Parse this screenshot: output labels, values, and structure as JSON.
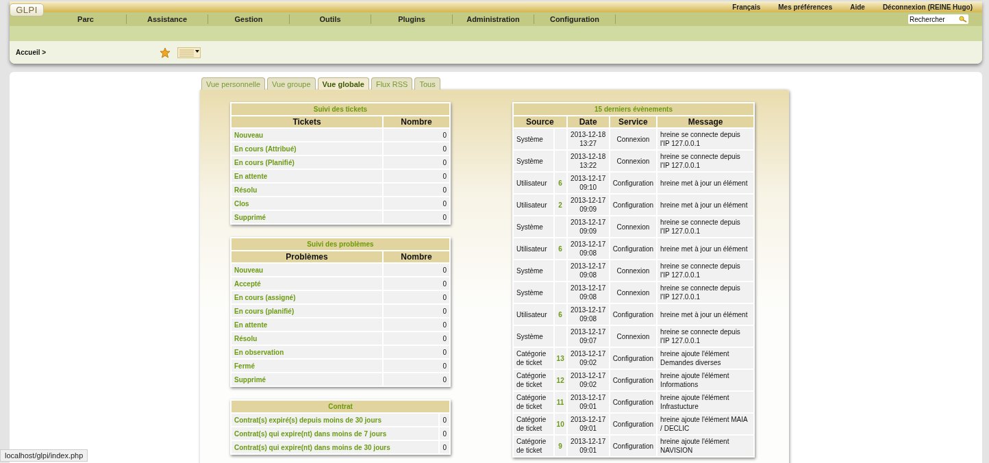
{
  "logo": "GLPI",
  "top_links": [
    "Français",
    "Mes préférences",
    "Aide",
    "Déconnexion (REINE Hugo)"
  ],
  "search": {
    "value": "Rechercher"
  },
  "menu": [
    "Parc",
    "Assistance",
    "Gestion",
    "Outils",
    "Plugins",
    "Administration",
    "Configuration"
  ],
  "breadcrumb": "Accueil >",
  "tabs": [
    {
      "label": "Vue personnelle",
      "selected": false
    },
    {
      "label": "Vue groupe",
      "selected": false
    },
    {
      "label": "Vue globale",
      "selected": true
    },
    {
      "label": "Flux RSS",
      "selected": false
    },
    {
      "label": "Tous",
      "selected": false
    }
  ],
  "tickets": {
    "title": "Suivi des tickets",
    "columns": [
      "Tickets",
      "Nombre"
    ],
    "rows": [
      {
        "label": "Nouveau",
        "count": "0"
      },
      {
        "label": "En cours (Attribué)",
        "count": "0"
      },
      {
        "label": "En cours (Planifié)",
        "count": "0"
      },
      {
        "label": "En attente",
        "count": "0"
      },
      {
        "label": "Résolu",
        "count": "0"
      },
      {
        "label": "Clos",
        "count": "0"
      },
      {
        "label": "Supprimé",
        "count": "0"
      }
    ]
  },
  "problems": {
    "title": "Suivi des problèmes",
    "columns": [
      "Problèmes",
      "Nombre"
    ],
    "rows": [
      {
        "label": "Nouveau",
        "count": "0"
      },
      {
        "label": "Accepté",
        "count": "0"
      },
      {
        "label": "En cours (assigné)",
        "count": "0"
      },
      {
        "label": "En cours (planifié)",
        "count": "0"
      },
      {
        "label": "En attente",
        "count": "0"
      },
      {
        "label": "Résolu",
        "count": "0"
      },
      {
        "label": "En observation",
        "count": "0"
      },
      {
        "label": "Fermé",
        "count": "0"
      },
      {
        "label": "Supprimé",
        "count": "0"
      }
    ]
  },
  "contracts": {
    "title": "Contrat",
    "rows": [
      {
        "label": "Contrat(s) expiré(s) depuis moins de 30 jours",
        "count": "0"
      },
      {
        "label": "Contrat(s) qui expire(nt) dans moins de 7 jours",
        "count": "0"
      },
      {
        "label": "Contrat(s) qui expire(nt) dans moins de 30 jours",
        "count": "0"
      }
    ]
  },
  "events": {
    "title": "15 derniers évènements",
    "columns": [
      "Source",
      "Date",
      "Service",
      "Message"
    ],
    "rows": [
      {
        "source": "Système",
        "item": "",
        "date": "2013-12-18",
        "time": "13:27",
        "service": "Connexion",
        "message": "hreine se connecte depuis l'IP 127.0.0.1"
      },
      {
        "source": "Système",
        "item": "",
        "date": "2013-12-18",
        "time": "13:22",
        "service": "Connexion",
        "message": "hreine se connecte depuis l'IP 127.0.0.1"
      },
      {
        "source": "Utilisateur",
        "item": "6",
        "date": "2013-12-17",
        "time": "09:10",
        "service": "Configuration",
        "message": "hreine met à jour un élément"
      },
      {
        "source": "Utilisateur",
        "item": "2",
        "date": "2013-12-17",
        "time": "09:09",
        "service": "Configuration",
        "message": "hreine met à jour un élément"
      },
      {
        "source": "Système",
        "item": "",
        "date": "2013-12-17",
        "time": "09:09",
        "service": "Connexion",
        "message": "hreine se connecte depuis l'IP 127.0.0.1"
      },
      {
        "source": "Utilisateur",
        "item": "6",
        "date": "2013-12-17",
        "time": "09:08",
        "service": "Configuration",
        "message": "hreine met à jour un élément"
      },
      {
        "source": "Système",
        "item": "",
        "date": "2013-12-17",
        "time": "09:08",
        "service": "Connexion",
        "message": "hreine se connecte depuis l'IP 127.0.0.1"
      },
      {
        "source": "Système",
        "item": "",
        "date": "2013-12-17",
        "time": "09:08",
        "service": "Connexion",
        "message": "hreine se connecte depuis l'IP 127.0.0.1"
      },
      {
        "source": "Utilisateur",
        "item": "6",
        "date": "2013-12-17",
        "time": "09:08",
        "service": "Configuration",
        "message": "hreine met à jour un élément"
      },
      {
        "source": "Système",
        "item": "",
        "date": "2013-12-17",
        "time": "09:07",
        "service": "Connexion",
        "message": "hreine se connecte depuis l'IP 127.0.0.1"
      },
      {
        "source": "Catégorie de ticket",
        "item": "13",
        "date": "2013-12-17",
        "time": "09:02",
        "service": "Configuration",
        "message": "hreine ajoute l'élément Demandes diverses"
      },
      {
        "source": "Catégorie de ticket",
        "item": "12",
        "date": "2013-12-17",
        "time": "09:02",
        "service": "Configuration",
        "message": "hreine ajoute l'élément Informations"
      },
      {
        "source": "Catégorie de ticket",
        "item": "11",
        "date": "2013-12-17",
        "time": "09:01",
        "service": "Configuration",
        "message": "hreine ajoute l'élément Infrastucture"
      },
      {
        "source": "Catégorie de ticket",
        "item": "10",
        "date": "2013-12-17",
        "time": "09:01",
        "service": "Configuration",
        "message": "hreine ajoute l'élément MAIA / DECLIC"
      },
      {
        "source": "Catégorie de ticket",
        "item": "9",
        "date": "2013-12-17",
        "time": "09:01",
        "service": "Configuration",
        "message": "hreine ajoute l'élément NAVISION"
      }
    ]
  },
  "status_url": "localhost/glpi/index.php"
}
